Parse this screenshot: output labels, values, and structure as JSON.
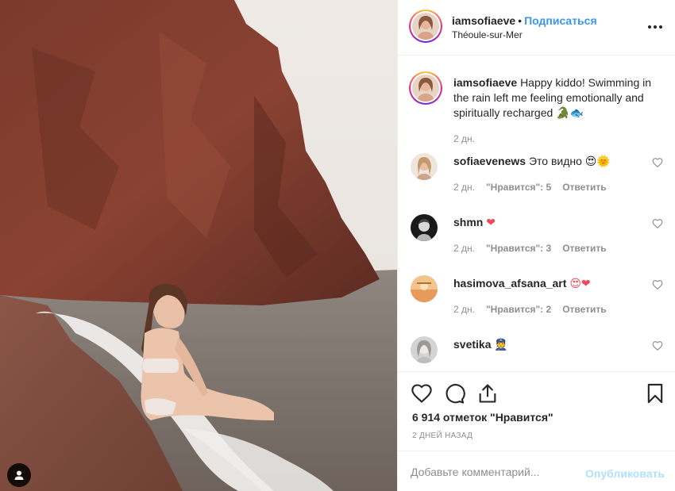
{
  "post": {
    "username": "iamsofiaeve",
    "separator": "•",
    "follow_label": "Подписаться",
    "location": "Théoule-sur-Mer",
    "more_icon": "more-horizontal-icon",
    "user_tag_icon": "user-icon"
  },
  "caption": {
    "username": "iamsofiaeve",
    "text": "Happy kiddo! Swimming in the rain left me feeling emotionally and spiritually recharged",
    "emojis": "🐊🐟",
    "time": "2 дн."
  },
  "comments": [
    {
      "username": "sofiaevenews",
      "text": "Это видно",
      "emojis": "😍🌞",
      "time": "2 дн.",
      "likes": "\"Нравится\": 5",
      "reply": "Ответить",
      "avatar_color": "#d9c6b4"
    },
    {
      "username": "shmn",
      "text": "",
      "emojis": "❤",
      "time": "2 дн.",
      "likes": "\"Нравится\": 3",
      "reply": "Ответить",
      "avatar_color": "#1a1a1a"
    },
    {
      "username": "hasimova_afsana_art",
      "text": "",
      "emojis": "😍❤",
      "time": "2 дн.",
      "likes": "\"Нравится\": 2",
      "reply": "Ответить",
      "avatar_color": "#f0b27a"
    },
    {
      "username": "svetika",
      "text": "",
      "emojis": "👮",
      "time": "",
      "likes": "",
      "reply": "",
      "avatar_color": "#cfcfcf"
    }
  ],
  "actions": {
    "like_icon": "heart-icon",
    "comment_icon": "comment-icon",
    "share_icon": "share-icon",
    "save_icon": "bookmark-icon",
    "likes_text": "6 914 отметок \"Нравится\"",
    "date_text": "2 ДНЕЙ НАЗАД"
  },
  "add_comment": {
    "placeholder": "Добавьте комментарий...",
    "publish_label": "Опубликовать"
  },
  "colors": {
    "link_blue": "#3897f0",
    "publish_disabled": "#b2dffc",
    "heart_red": "#ed4956",
    "meta_gray": "#8e8e8e"
  }
}
